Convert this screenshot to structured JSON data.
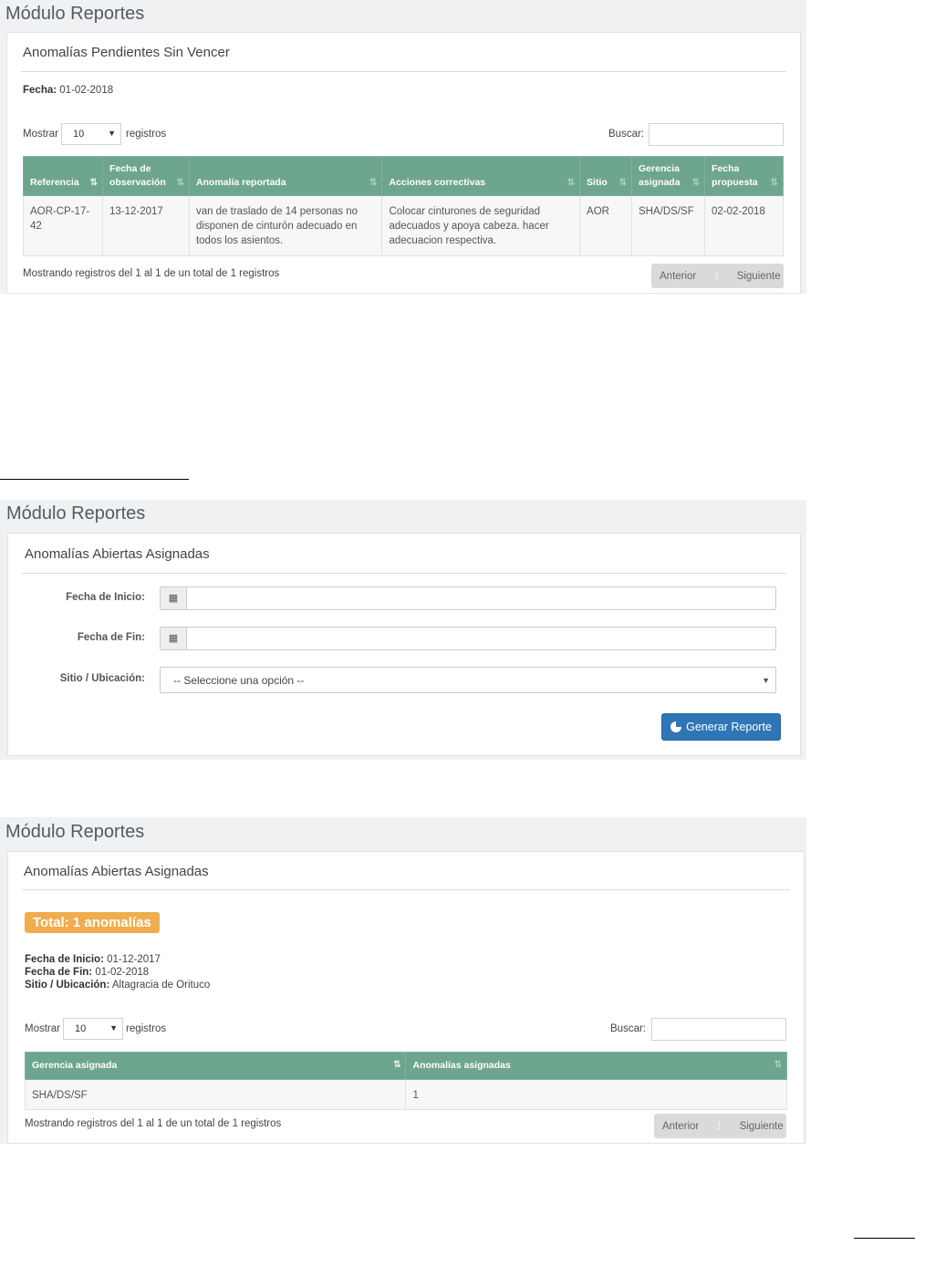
{
  "screen1": {
    "module_title": "Módulo Reportes",
    "panel_title": "Anomalías Pendientes Sin Vencer",
    "fecha_label": "Fecha:",
    "fecha_value": "01-02-2018",
    "length": {
      "prefix": "Mostrar",
      "value": "10",
      "suffix": "registros"
    },
    "search_label": "Buscar:",
    "columns": [
      "Referencia",
      "Fecha de observación",
      "Anomalía reportada",
      "Acciones correctivas",
      "Sitio",
      "Gerencia asignada",
      "Fecha propuesta"
    ],
    "rows": [
      [
        "AOR-CP-17-42",
        "13-12-2017",
        "van de traslado de 14 personas no disponen de cinturón adecuado en todos los asientos.",
        "Colocar cinturones de seguridad adecuados y apoya cabeza. hacer adecuacion respectiva.",
        "AOR",
        "SHA/DS/SF",
        "02-02-2018"
      ]
    ],
    "info": "Mostrando registros del 1 al 1 de un total de 1 registros",
    "pager": {
      "prev": "Anterior",
      "page": "1",
      "next": "Siguiente"
    }
  },
  "screen2": {
    "module_title": "Módulo Reportes",
    "panel_title": "Anomalías Abiertas Asignadas",
    "fecha_inicio_label": "Fecha de Inicio:",
    "fecha_fin_label": "Fecha de Fin:",
    "sitio_label": "Sitio / Ubicación:",
    "sitio_selected": "-- Seleccione una opción --",
    "button_label": "Generar Reporte"
  },
  "screen3": {
    "module_title": "Módulo Reportes",
    "panel_title": "Anomalías Abiertas Asignadas",
    "total_badge": "Total: 1 anomalías",
    "fecha_inicio_label": "Fecha de Inicio:",
    "fecha_inicio_value": "01-12-2017",
    "fecha_fin_label": "Fecha de Fin:",
    "fecha_fin_value": "01-02-2018",
    "sitio_label": "Sitio / Ubicación:",
    "sitio_value": "Altagracia de Orituco",
    "length": {
      "prefix": "Mostrar",
      "value": "10",
      "suffix": "registros"
    },
    "search_label": "Buscar:",
    "columns": [
      "Gerencia asignada",
      "Anomalías asignadas"
    ],
    "rows": [
      [
        "SHA/DS/SF",
        "1"
      ]
    ],
    "info": "Mostrando registros del 1 al 1 de un total de 1 registros",
    "pager": {
      "prev": "Anterior",
      "page": "1",
      "next": "Siguiente"
    }
  },
  "colors": {
    "header_green": "#6ea58e",
    "primary_blue": "#2f76b7",
    "badge_orange": "#f0ad4e",
    "page_bg": "#f0f1f3"
  }
}
